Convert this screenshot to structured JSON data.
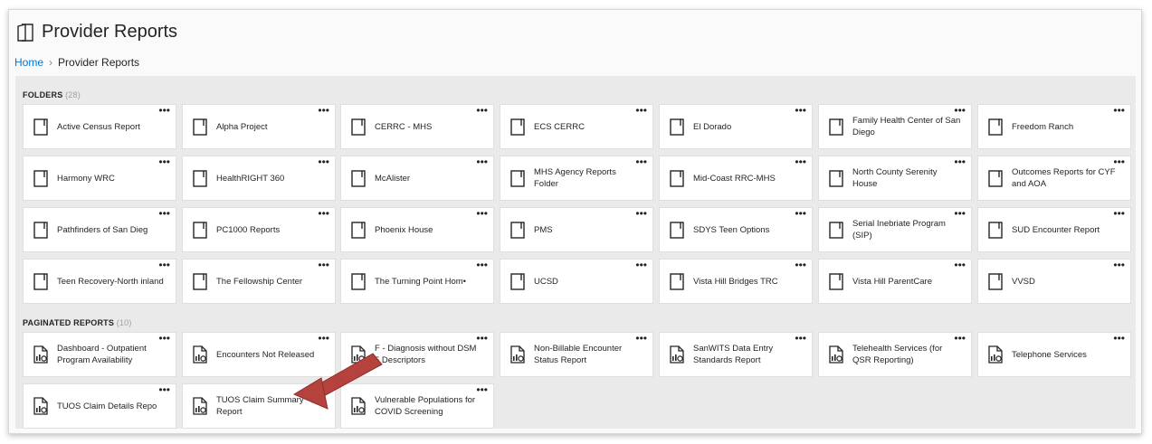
{
  "page": {
    "title": "Provider Reports"
  },
  "breadcrumb": {
    "home": "Home",
    "separator": "›",
    "current": "Provider Reports"
  },
  "folders": {
    "label": "FOLDERS",
    "count": "(28)",
    "items": [
      "Active Census Report",
      "Alpha Project",
      "CERRC - MHS",
      "ECS CERRC",
      "El Dorado",
      "Family Health Center of San Diego",
      "Freedom Ranch",
      "Harmony WRC",
      "HealthRIGHT 360",
      "McAlister",
      "MHS Agency Reports Folder",
      "Mid-Coast RRC-MHS",
      "North County Serenity House",
      "Outcomes Reports for CYF and AOA",
      "Pathfinders of San Dieg",
      "PC1000 Reports",
      "Phoenix House",
      "PMS",
      "SDYS Teen Options",
      "Serial Inebriate Program (SIP)",
      "SUD Encounter Report",
      "Teen Recovery-North inland",
      "The Fellowship Center",
      "The Turning Point Hom•",
      "UCSD",
      "Vista Hill Bridges TRC",
      "Vista Hill ParentCare",
      "VVSD"
    ]
  },
  "paginated": {
    "label": "PAGINATED REPORTS",
    "count": "(10)",
    "items": [
      "Dashboard - Outpatient Program Availability",
      "Encounters Not Released",
      "F - Diagnosis without DSM 5 Descriptors",
      "Non-Billable Encounter Status Report",
      "SanWITS Data Entry Standards Report",
      "Telehealth Services (for QSR Reporting)",
      "Telephone Services",
      "TUOS Claim Details Repo",
      "TUOS Claim Summary Report",
      "Vulnerable Populations for COVID Screening"
    ]
  },
  "more_glyph": "•••",
  "colors": {
    "accent": "#0078d4",
    "arrow": "#b5423c",
    "background": "#eaeaea"
  },
  "icons": {
    "header": "report-folder-icon",
    "folder": "folder-icon",
    "paginated": "paginated-report-icon"
  }
}
